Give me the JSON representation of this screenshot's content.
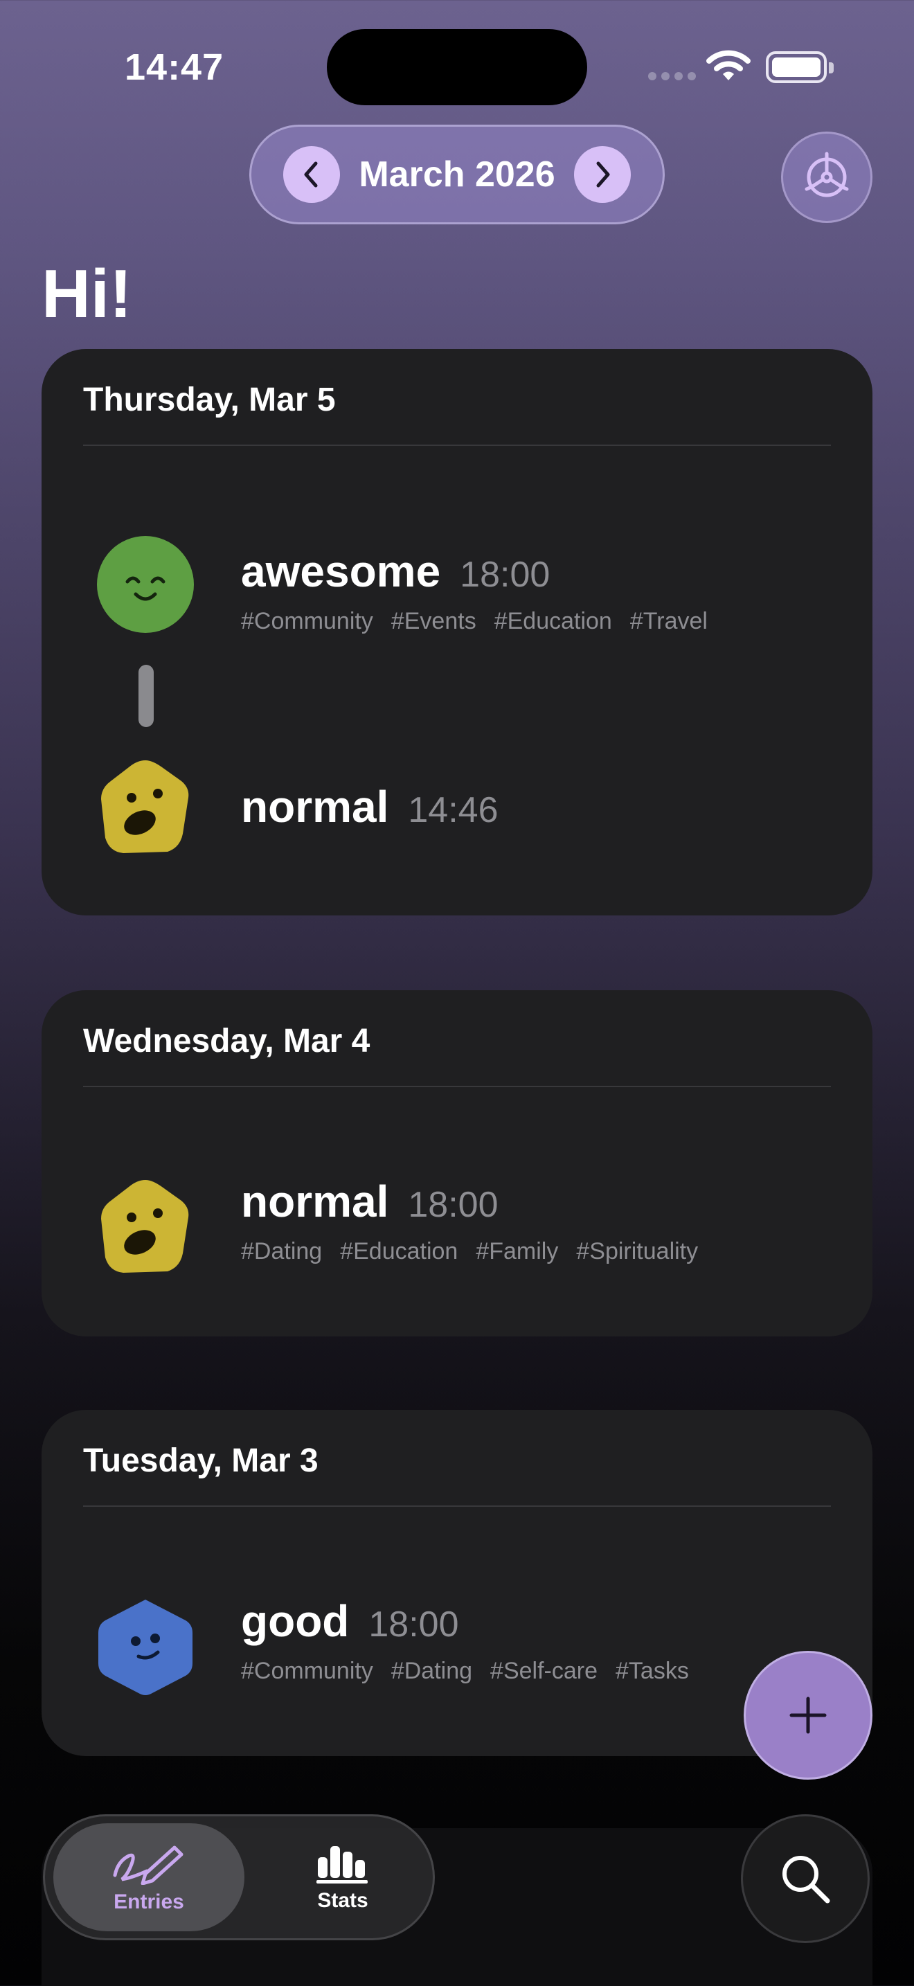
{
  "status_bar": {
    "time": "14:47"
  },
  "header": {
    "month_label": "March 2026",
    "greeting": "Hi!"
  },
  "colors": {
    "accent": "#d8c0f7",
    "awesome": "#5e9f43",
    "normal": "#ccb534",
    "good": "#4a72c9",
    "fab": "#9a80c8"
  },
  "days": [
    {
      "date": "Thursday, Mar 5",
      "entries": [
        {
          "mood": "awesome",
          "time": "18:00",
          "icon": "awesome-face-icon",
          "tags": [
            "#Community",
            "#Events",
            "#Education",
            "#Travel"
          ]
        },
        {
          "mood": "normal",
          "time": "14:46",
          "icon": "normal-face-icon",
          "tags": []
        }
      ]
    },
    {
      "date": "Wednesday, Mar 4",
      "entries": [
        {
          "mood": "normal",
          "time": "18:00",
          "icon": "normal-face-icon",
          "tags": [
            "#Dating",
            "#Education",
            "#Family",
            "#Spirituality"
          ]
        }
      ]
    },
    {
      "date": "Tuesday, Mar 3",
      "entries": [
        {
          "mood": "good",
          "time": "18:00",
          "icon": "good-face-icon",
          "tags": [
            "#Community",
            "#Dating",
            "#Self-care",
            "#Tasks"
          ]
        }
      ]
    }
  ],
  "tabbar": {
    "entries_label": "Entries",
    "stats_label": "Stats"
  }
}
